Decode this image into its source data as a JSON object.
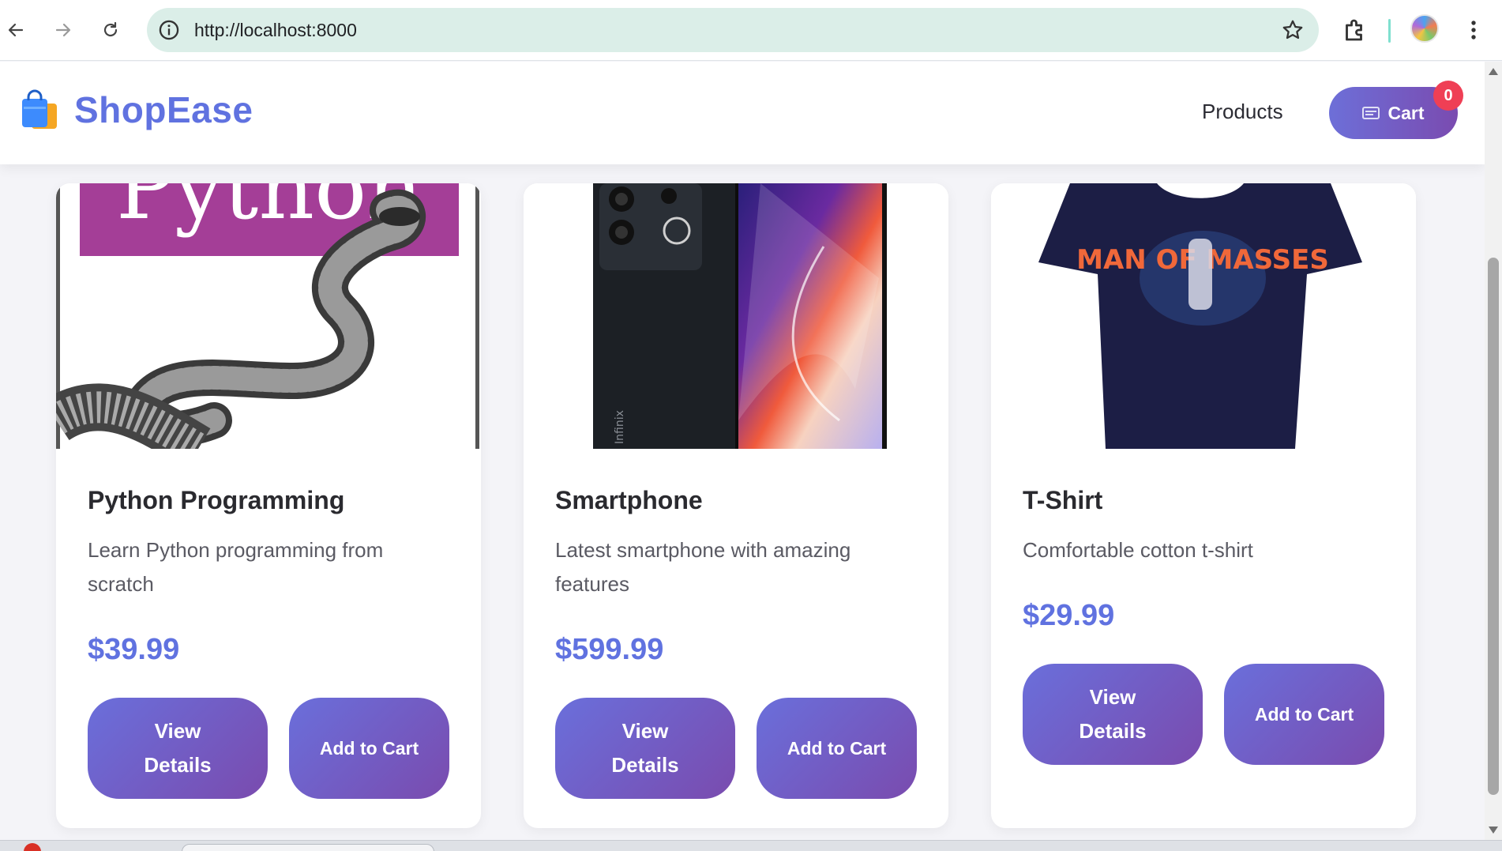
{
  "browser": {
    "url": "http://localhost:8000",
    "icons": {
      "back": "arrow-left-icon",
      "forward": "arrow-right-icon",
      "reload": "reload-icon",
      "info": "info-icon",
      "bookmark": "star-icon",
      "extensions": "puzzle-icon",
      "menu": "kebab-menu-icon"
    }
  },
  "site": {
    "brand_name": "ShopEase",
    "brand_icon": "shopping-bag-icon",
    "nav_products": "Products",
    "cart_label": "Cart",
    "cart_icon": "cart-icon",
    "cart_count": "0"
  },
  "products": [
    {
      "name": "Python Programming",
      "description": "Learn Python programming from scratch",
      "price": "$39.99",
      "view_label": "View Details",
      "add_label": "Add to Cart",
      "image_text": "Python"
    },
    {
      "name": "Smartphone",
      "description": "Latest smartphone with amazing features",
      "price": "$599.99",
      "view_label": "View Details",
      "add_label": "Add to Cart",
      "image_text": "Infinix"
    },
    {
      "name": "T-Shirt",
      "description": "Comfortable cotton t-shirt",
      "price": "$29.99",
      "view_label": "View Details",
      "add_label": "Add to Cart",
      "image_text": "MAN OF MASSES"
    }
  ],
  "colors": {
    "brand": "#6072e0",
    "button_gradient_start": "#6a6fdb",
    "button_gradient_end": "#7a4bae",
    "badge": "#ef3f55",
    "omnibox": "#dbeee8"
  }
}
